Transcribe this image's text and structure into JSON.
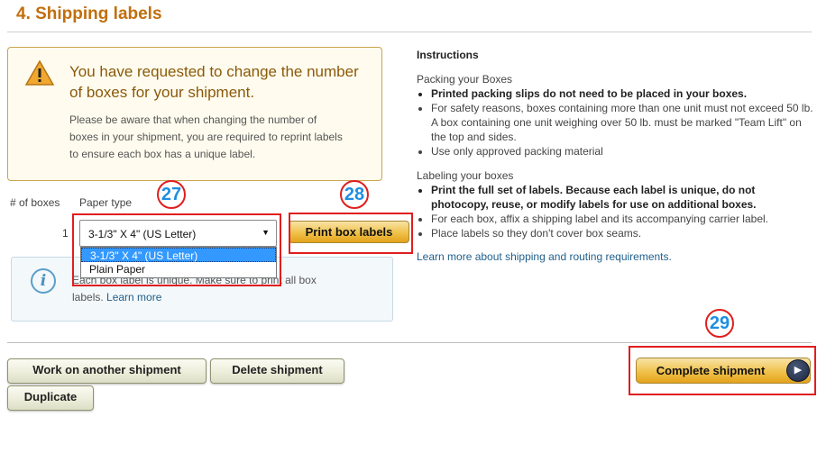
{
  "section_title": "4. Shipping labels",
  "warning": {
    "heading": "You have requested to change the number of boxes for your shipment.",
    "body": "Please be aware that when changing the number of boxes in your shipment, you are required to reprint labels to ensure each box has a unique label."
  },
  "table": {
    "col_boxes": "# of boxes",
    "col_paper": "Paper type",
    "row_number": "1",
    "selected_paper": "3-1/3\" X 4\" (US Letter)",
    "options": [
      "3-1/3\" X 4\" (US Letter)",
      "Plain Paper"
    ]
  },
  "print_button": "Print box labels",
  "info": {
    "text": "Each box label is unique. Make sure to print all box labels.",
    "learn_more": "Learn more"
  },
  "instructions": {
    "title": "Instructions",
    "packing_heading": "Packing your Boxes",
    "packing_items": [
      "Printed packing slips do not need to be placed in your boxes.",
      "For safety reasons, boxes containing more than one unit must not exceed 50 lb. A box containing one unit weighing over 50 lb. must be marked \"Team Lift\" on the top and sides.",
      "Use only approved packing material"
    ],
    "labeling_heading": "Labeling your boxes",
    "labeling_items": [
      "Print the full set of labels. Because each label is unique, do not photocopy, reuse, or modify labels for use on additional boxes.",
      "For each box, affix a shipping label and its accompanying carrier label.",
      "Place labels so they don't cover box seams."
    ],
    "learn_link": "Learn more about shipping and routing requirements."
  },
  "buttons": {
    "work_another": "Work on another shipment",
    "delete": "Delete shipment",
    "duplicate": "Duplicate",
    "complete": "Complete shipment"
  },
  "annotations": [
    "27",
    "28",
    "29"
  ],
  "colors": {
    "title": "#c26e0c",
    "annotation_red": "#e01e1e",
    "annotation_blue": "#1e8fe0",
    "select_highlight": "#3399ff"
  }
}
